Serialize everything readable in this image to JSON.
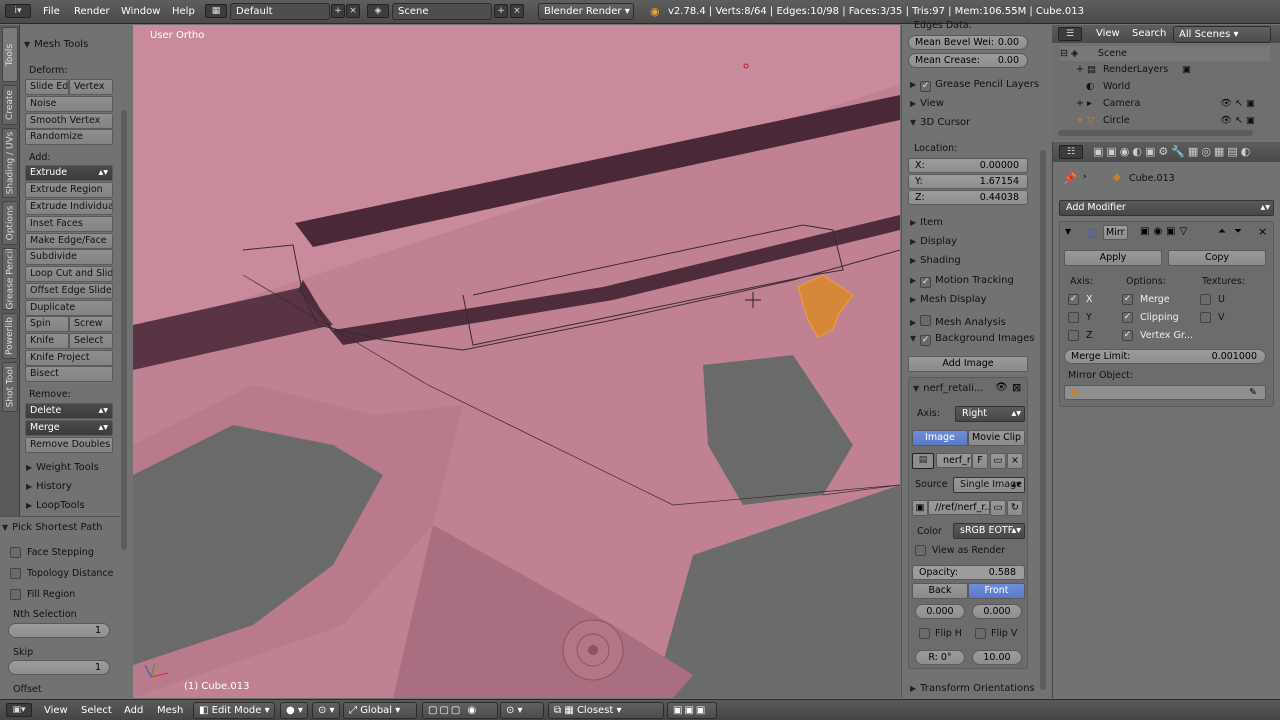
{
  "topbar": {
    "menus": [
      "File",
      "Render",
      "Window",
      "Help"
    ],
    "layout": "Default",
    "scene": "Scene",
    "engine": "Blender Render",
    "stats": "v2.78.4 | Verts:8/64 | Edges:10/98 | Faces:3/35 | Tris:97 | Mem:106.55M | Cube.013"
  },
  "tabs": [
    "Tools",
    "Create",
    "Shading / UVs",
    "Options",
    "Grease Pencil",
    "Powerlib",
    "Shot Tool"
  ],
  "tool": {
    "mesh_tools": "Mesh Tools",
    "deform_label": "Deform:",
    "slide_edge": "Slide Ed",
    "vertex": "Vertex",
    "noise": "Noise",
    "smooth_vertex": "Smooth Vertex",
    "randomize": "Randomize",
    "add_label": "Add:",
    "extrude": "Extrude",
    "extrude_region": "Extrude Region",
    "extrude_individual": "Extrude Individual",
    "inset_faces": "Inset Faces",
    "make_edge_face": "Make Edge/Face",
    "subdivide": "Subdivide",
    "loop_cut": "Loop Cut and Slide",
    "offset_edge": "Offset Edge Slide",
    "duplicate": "Duplicate",
    "spin": "Spin",
    "screw": "Screw",
    "knife": "Knife",
    "select": "Select",
    "knife_project": "Knife Project",
    "bisect": "Bisect",
    "remove_label": "Remove:",
    "delete": "Delete",
    "merge": "Merge",
    "remove_doubles": "Remove Doubles",
    "weight_tools": "Weight Tools",
    "history": "History",
    "looptools": "LoopTools",
    "pick_shortest": "Pick Shortest Path",
    "face_stepping": "Face Stepping",
    "topology_distance": "Topology Distance",
    "fill_region": "Fill Region",
    "nth_selection": "Nth Selection",
    "nth_value": "1",
    "skip": "Skip",
    "skip_value": "1",
    "offset": "Offset"
  },
  "viewport": {
    "view_label": "User Ortho",
    "object_label": "(1) Cube.013"
  },
  "npanel": {
    "edges_data": "Edges Data:",
    "mean_bevel": "Mean Bevel Wei:",
    "mean_bevel_val": "0.00",
    "mean_crease": "Mean Crease:",
    "mean_crease_val": "0.00",
    "grease_pencil_layers": "Grease Pencil Layers",
    "view": "View",
    "cursor": "3D Cursor",
    "location": "Location:",
    "x": "X:",
    "x_val": "0.00000",
    "y": "Y:",
    "y_val": "1.67154",
    "z": "Z:",
    "z_val": "0.44038",
    "item": "Item",
    "display": "Display",
    "shading": "Shading",
    "motion_tracking": "Motion Tracking",
    "mesh_display": "Mesh Display",
    "mesh_analysis": "Mesh Analysis",
    "background_images": "Background Images",
    "add_image": "Add Image",
    "bg_name": "nerf_retali...",
    "axis": "Axis:",
    "axis_val": "Right",
    "image": "Image",
    "movie_clip": "Movie Clip",
    "img_name": "nerf_re",
    "img_f": "F",
    "source": "Source",
    "source_val": "Single Image",
    "filepath": "//ref/nerf_r...",
    "color": "Color",
    "color_val": "sRGB EOTF",
    "view_as_render": "View as Render",
    "opacity": "Opacity:",
    "opacity_val": "0.588",
    "back": "Back",
    "front": "Front",
    "offx": "0.000",
    "offy": "0.000",
    "flip_h": "Flip H",
    "flip_v": "Flip V",
    "rot": "R: 0°",
    "size": "10.00",
    "transform_orientations": "Transform Orientations"
  },
  "outliner": {
    "view": "View",
    "search": "Search",
    "filter": "All Scenes",
    "items": [
      "Scene",
      "RenderLayers",
      "World",
      "Camera",
      "Circle"
    ]
  },
  "props": {
    "object_name": "Cube.013",
    "add_modifier": "Add Modifier",
    "mod_name": "Mirr",
    "apply": "Apply",
    "copy": "Copy",
    "axis": "Axis:",
    "options": "Options:",
    "textures": "Textures:",
    "ax_x": "X",
    "ax_y": "Y",
    "ax_z": "Z",
    "merge": "Merge",
    "clipping": "Clipping",
    "vertex_gr": "Vertex Gr...",
    "tex_u": "U",
    "tex_v": "V",
    "merge_limit": "Merge Limit:",
    "merge_limit_val": "0.001000",
    "mirror_object": "Mirror Object:"
  },
  "bottombar": {
    "view": "View",
    "select": "Select",
    "add": "Add",
    "mesh": "Mesh",
    "mode": "Edit Mode",
    "orientation": "Global",
    "snap": "Closest"
  }
}
